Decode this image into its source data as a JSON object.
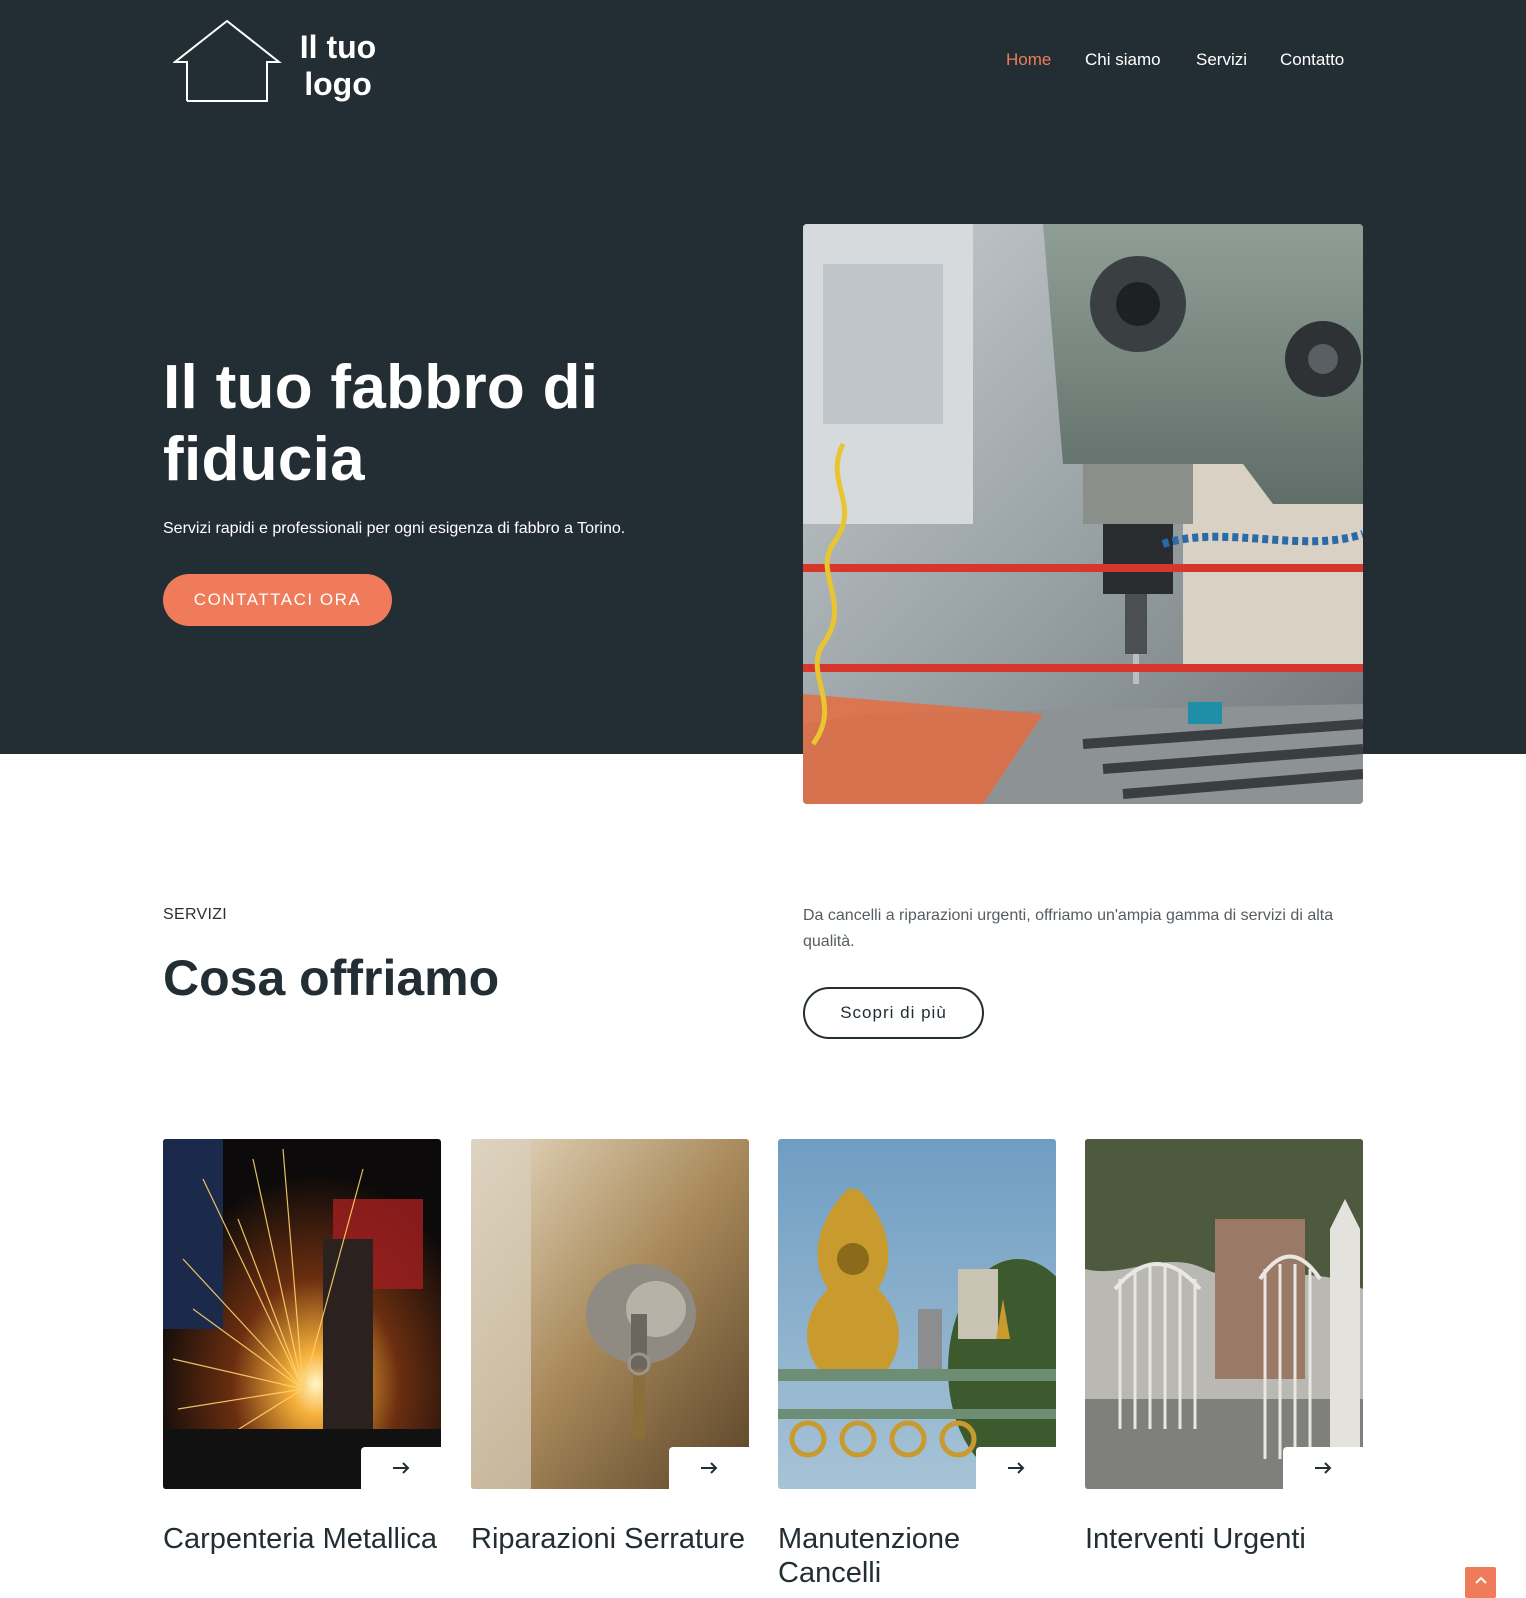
{
  "header": {
    "logo_line1": "Il tuo",
    "logo_line2": "logo",
    "nav": [
      {
        "label": "Home",
        "active": true
      },
      {
        "label": "Chi siamo",
        "active": false
      },
      {
        "label": "Servizi",
        "active": false
      },
      {
        "label": "Contatto",
        "active": false
      }
    ]
  },
  "hero": {
    "title_line1": "Il tuo fabbro di",
    "title_line2": "fiducia",
    "subtitle": "Servizi rapidi e professionali per ogni esigenza di fabbro a Torino.",
    "cta_label": "CONTATTACI ORA"
  },
  "services": {
    "eyebrow": "SERVIZI",
    "title": "Cosa offriamo",
    "description": "Da cancelli a riparazioni urgenti, offriamo un'ampia gamma di servizi di alta qualità.",
    "more_label": "Scopri di più",
    "cards": [
      {
        "title": "Carpenteria Metallica",
        "icon": "arrow-right-icon"
      },
      {
        "title": "Riparazioni Serrature",
        "icon": "arrow-right-icon"
      },
      {
        "title": "Manutenzione Cancelli",
        "icon": "arrow-right-icon"
      },
      {
        "title": "Interventi Urgenti",
        "icon": "arrow-right-icon"
      }
    ]
  },
  "colors": {
    "dark": "#232e34",
    "accent": "#ef7b5a",
    "white": "#ffffff"
  }
}
